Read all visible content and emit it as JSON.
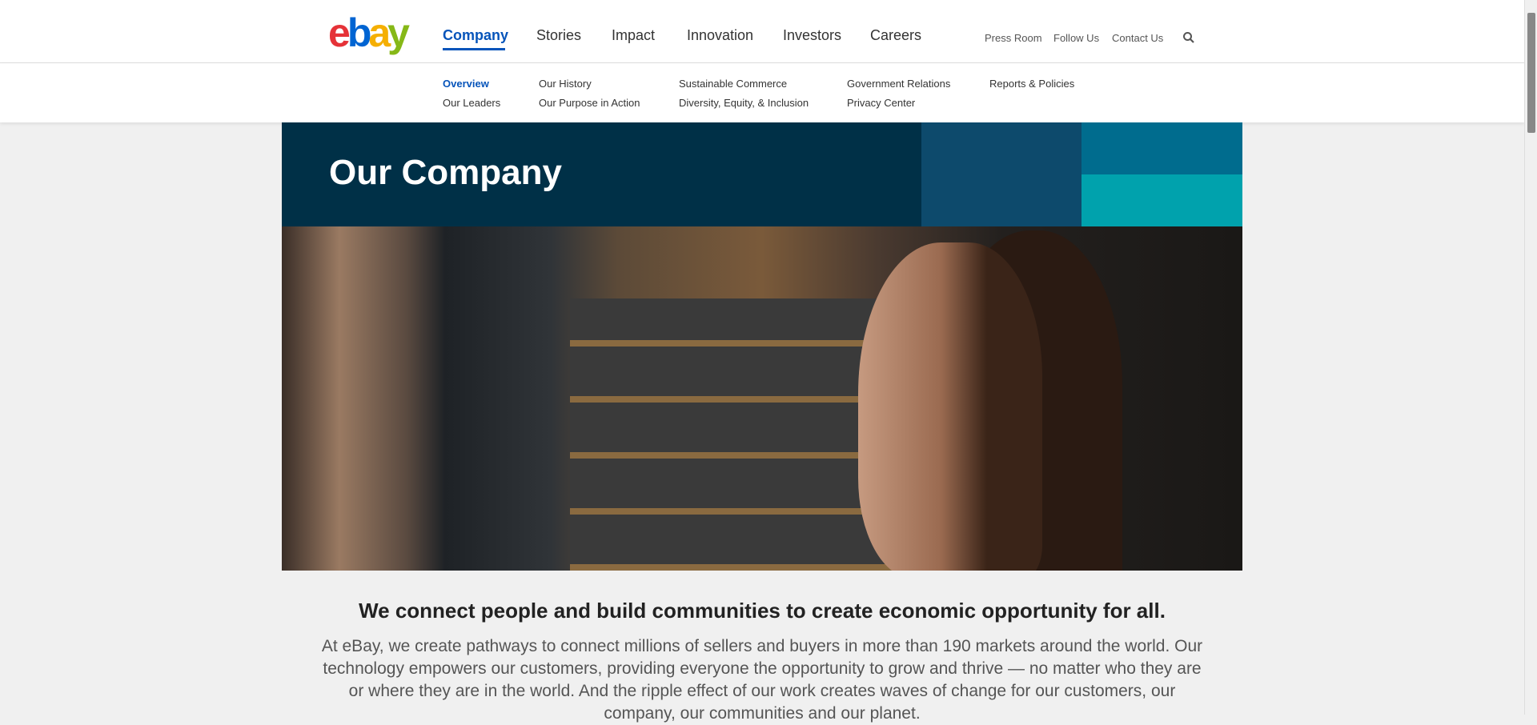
{
  "header": {
    "logo": "ebay",
    "nav": [
      "Company",
      "Stories",
      "Impact",
      "Innovation",
      "Investors",
      "Careers"
    ],
    "active_nav": "Company",
    "utility": [
      "Press Room",
      "Follow Us",
      "Contact Us"
    ],
    "search_icon": "search-icon"
  },
  "subnav": {
    "items": [
      "Overview",
      "Our History",
      "Sustainable Commerce",
      "Government Relations",
      "Reports & Policies",
      "Our Leaders",
      "Our Purpose in Action",
      "Diversity, Equity, & Inclusion",
      "Privacy Center"
    ],
    "active": "Overview"
  },
  "hero": {
    "title": "Our Company",
    "colors": [
      "#003047",
      "#0d4a6c",
      "#006c8e",
      "#00a2ad"
    ]
  },
  "content": {
    "headline": "We connect people and build communities to create economic opportunity for all.",
    "paragraph": "At eBay, we create pathways to connect millions of sellers and buyers in more than 190 markets around the world. Our technology empowers our customers, providing everyone the opportunity to grow and thrive — no matter who they are or where they are in the world. And the ripple effect of our work creates waves of change for our customers, our company, our communities and our planet."
  }
}
